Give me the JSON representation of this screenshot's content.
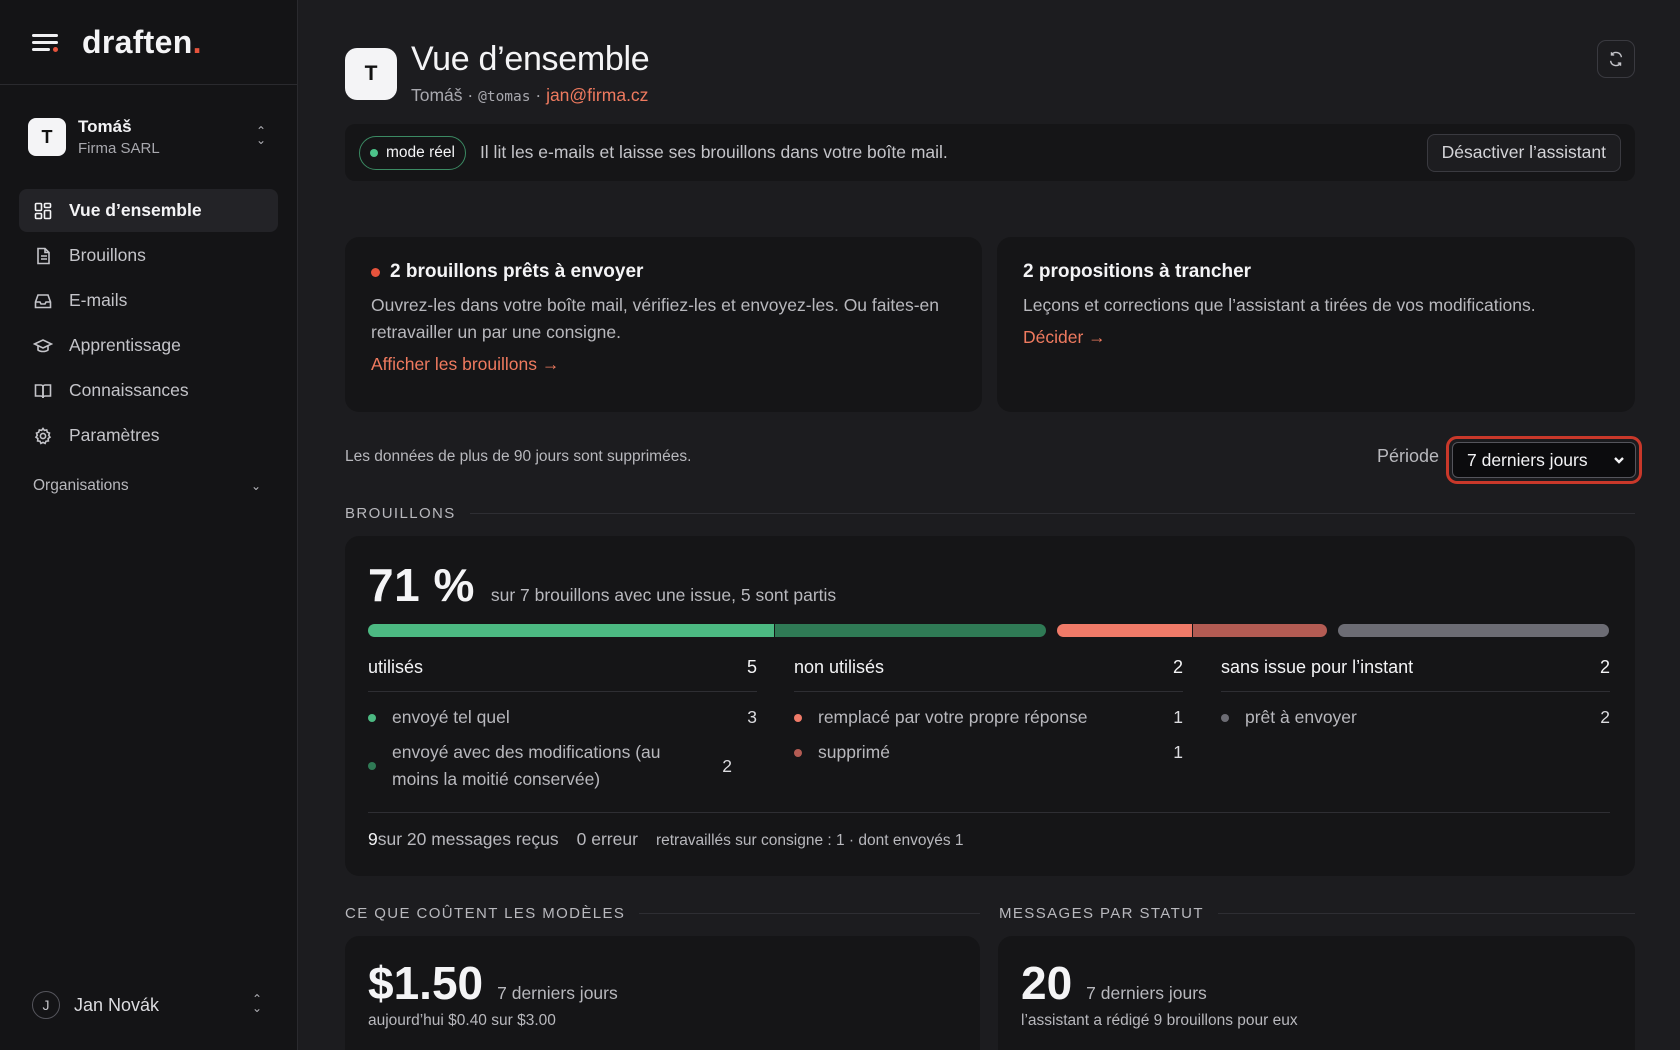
{
  "brand": {
    "logo": "draften",
    "logo_dot": "."
  },
  "account": {
    "initial": "T",
    "name": "Tomáš",
    "company": "Firma SARL"
  },
  "nav": [
    {
      "label": "Vue d’ensemble",
      "icon": "dashboard-icon",
      "active": true
    },
    {
      "label": "Brouillons",
      "icon": "document-icon",
      "active": false
    },
    {
      "label": "E-mails",
      "icon": "inbox-icon",
      "active": false
    },
    {
      "label": "Apprentissage",
      "icon": "graduation-cap-icon",
      "active": false
    },
    {
      "label": "Connaissances",
      "icon": "book-icon",
      "active": false
    },
    {
      "label": "Paramètres",
      "icon": "gear-icon",
      "active": false
    }
  ],
  "orgs_label": "Organisations",
  "user": {
    "initial": "J",
    "name": "Jan Novák"
  },
  "header": {
    "initial": "T",
    "title": "Vue d’ensemble",
    "name": "Tomáš",
    "sep": " · ",
    "handle": "@tomas",
    "email": "jan@firma.cz"
  },
  "mode": {
    "pill": "mode réel",
    "description": "Il lit les e-mails et laisse ses brouillons dans votre boîte mail.",
    "button": "Désactiver l’assistant"
  },
  "cards": {
    "drafts_ready": {
      "title": "2 brouillons prêts à envoyer",
      "text": "Ouvrez-les dans votre boîte mail, vérifiez-les et envoyez-les. Ou faites-en retravailler un par une consigne.",
      "link": "Afficher les brouillons →"
    },
    "proposals": {
      "title": "2 propositions à trancher",
      "text": "Leçons et corrections que l’assistant a tirées de vos modifications.",
      "link": "Décider →"
    }
  },
  "retention_note": "Les données de plus de 90 jours sont supprimées.",
  "period": {
    "label": "Période",
    "selected": "7 derniers jours"
  },
  "drafts": {
    "section": "BROUILLONS",
    "percent": "71 %",
    "summary": "sur 7 brouillons avec une issue, 5 sont partis",
    "bar": [
      {
        "name": "envoyé tel quel",
        "value": 3,
        "color": "#4cb982"
      },
      {
        "name": "envoyé avec des modifications",
        "value": 2,
        "color": "#2f7a55"
      },
      {
        "name": "remplacé par votre propre réponse",
        "value": 1,
        "color": "#ef7a68"
      },
      {
        "name": "supprimé",
        "value": 1,
        "color": "#b35b53"
      },
      {
        "name": "prêt à envoyer",
        "value": 2,
        "color": "#6c6c74"
      }
    ],
    "columns": [
      {
        "title": "utilisés",
        "count": "5",
        "items": [
          {
            "label": "envoyé tel quel",
            "value": "3",
            "color": "#4cb982"
          },
          {
            "label": "envoyé avec des modifications (au moins la moitié conservée)",
            "value": "2",
            "color": "#2f7a55"
          }
        ]
      },
      {
        "title": "non utilisés",
        "count": "2",
        "items": [
          {
            "label": "remplacé par votre propre réponse",
            "value": "1",
            "color": "#ef7a68"
          },
          {
            "label": "supprimé",
            "value": "1",
            "color": "#b35b53"
          }
        ]
      },
      {
        "title": "sans issue pour l’instant",
        "count": "2",
        "items": [
          {
            "label": "prêt à envoyer",
            "value": "2",
            "color": "#6c6c74"
          }
        ]
      }
    ],
    "footer": {
      "received_bold": "9",
      "received_text": " sur 20 messages reçus",
      "errors": "0 erreur",
      "reworked": "retravaillés sur consigne : 1 · dont envoyés 1"
    }
  },
  "costs": {
    "section": "CE QUE COÛTENT LES MODÈLES",
    "amount": "$1.50",
    "period": "7 derniers jours",
    "note": "aujourd’hui $0.40 sur $3.00"
  },
  "status": {
    "section": "MESSAGES PAR STATUT",
    "amount": "20",
    "period": "7 derniers jours",
    "note": "l’assistant a rédigé 9 brouillons pour eux"
  }
}
